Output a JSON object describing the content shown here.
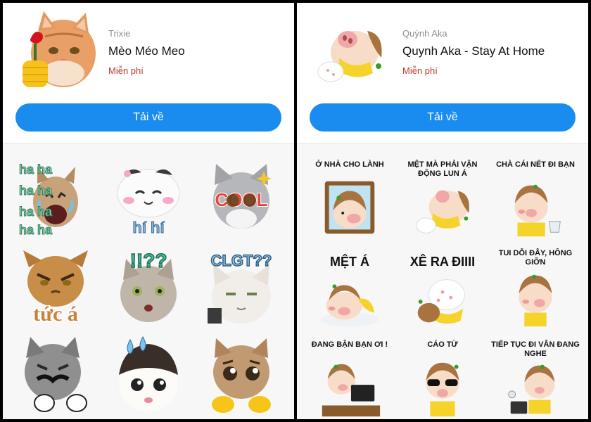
{
  "left_panel": {
    "author": "Trixie",
    "title": "Mèo Méo Meo",
    "price": "Miễn phí",
    "download_label": "Tải về",
    "stickers": [
      {
        "name": "sticker-haha-cat",
        "text": "ha ha"
      },
      {
        "name": "sticker-hihi-cat",
        "text": "hí hí"
      },
      {
        "name": "sticker-cool-cat",
        "text": "COOL"
      },
      {
        "name": "sticker-tuc-a-cat",
        "text": "tức á"
      },
      {
        "name": "sticker-question-cat",
        "text": "!!??"
      },
      {
        "name": "sticker-clgt-cat",
        "text": "CLGT??"
      },
      {
        "name": "sticker-mustache-cat",
        "text": ""
      },
      {
        "name": "sticker-sweat-cat",
        "text": ""
      },
      {
        "name": "sticker-pleading-cat",
        "text": ""
      }
    ]
  },
  "right_panel": {
    "author": "Quỳnh Aka",
    "title": "Quynh Aka - Stay At Home",
    "price": "Miễn phí",
    "download_label": "Tải về",
    "stickers": [
      {
        "name": "sticker-o-nha",
        "caption": "Ở NHÀ CHO LÀNH"
      },
      {
        "name": "sticker-met-ma-phai",
        "caption": "MỆT MÀ PHẢI VẬN ĐỘNG LUN Á"
      },
      {
        "name": "sticker-cha-cai-net",
        "caption": "CHÀ CÁI NẾT ĐI BẠN"
      },
      {
        "name": "sticker-met-a",
        "caption": "MỆT Á"
      },
      {
        "name": "sticker-xe-ra",
        "caption": "XÊ RA ĐIIII"
      },
      {
        "name": "sticker-tui-doi-day",
        "caption": "TUI DỖI ĐÂY, HÔNG GIỠN"
      },
      {
        "name": "sticker-dang-ban",
        "caption": "ĐANG BẬN BẠN ƠI !"
      },
      {
        "name": "sticker-cao-tu",
        "caption": "CÁO TỪ"
      },
      {
        "name": "sticker-tiep-tuc",
        "caption": "TIẾP TỤC ĐI VẪN ĐANG NGHE"
      }
    ]
  },
  "colors": {
    "download_button": "#1a8cf0",
    "price_text": "#c0392b",
    "author_text": "#8e8e93",
    "sticker_area": "#f7f7f8"
  }
}
